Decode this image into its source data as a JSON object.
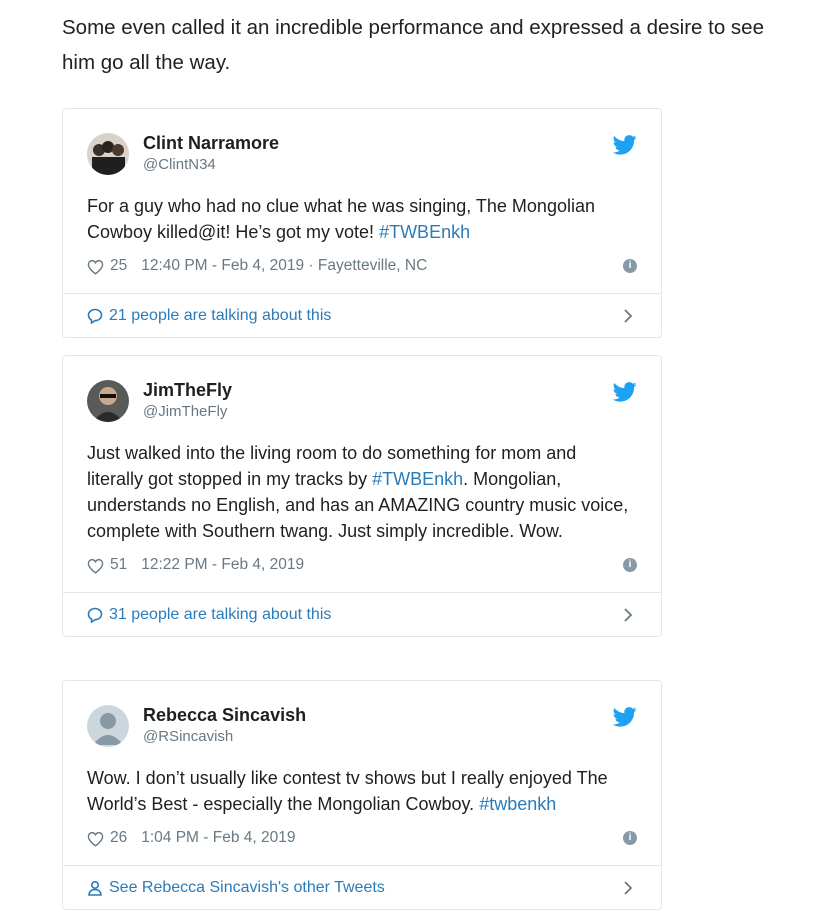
{
  "intro": "Some even called it an incredible performance and expressed a desire to see him go all the way.",
  "tweets": [
    {
      "name": "Clint Narramore",
      "handle": "@ClintN34",
      "text_main": "For a guy who had no clue what he was singing, The Mongolian Cowboy killed@it!  He’s got my vote! ",
      "hashtag": "#TWBEnkh",
      "text_after": "",
      "likes": "25",
      "timestamp": "12:40 PM - Feb 4, 2019 · Fayetteville, NC",
      "footer": "21 people are talking about this",
      "footer_icon": "speech-bubble-icon"
    },
    {
      "name": "JimTheFly",
      "handle": "@JimTheFly",
      "text_main": "Just walked into the living room to do something for mom and literally got stopped in my tracks by ",
      "hashtag": "#TWBEnkh",
      "text_after": ".  Mongolian, understands no English, and has an AMAZING country music voice, complete with Southern twang.  Just simply incredible. Wow.",
      "likes": "51",
      "timestamp": "12:22 PM - Feb 4, 2019",
      "footer": "31 people are talking about this",
      "footer_icon": "speech-bubble-icon"
    },
    {
      "name": "Rebecca Sincavish",
      "handle": "@RSincavish",
      "text_main": "Wow. I don’t usually like contest tv shows but I really enjoyed The World’s Best - especially the Mongolian Cowboy. ",
      "hashtag": "#twbenkh",
      "text_after": "",
      "likes": "26",
      "timestamp": "1:04 PM - Feb 4, 2019",
      "footer": "See Rebecca Sincavish's other Tweets",
      "footer_icon": "person-icon"
    }
  ],
  "colors": {
    "link": "#2b7bb9",
    "muted": "#697882",
    "border": "#e1e8ed",
    "bird": "#1da1f2"
  }
}
